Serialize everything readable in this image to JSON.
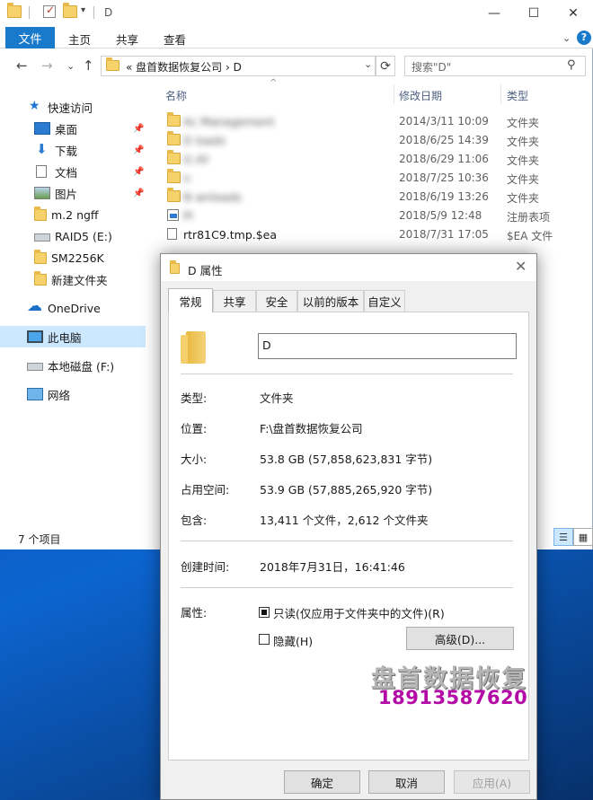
{
  "window": {
    "title": "D",
    "controls": {
      "minimize": "—",
      "maximize": "☐",
      "close": "✕"
    }
  },
  "ribbon": {
    "file": "文件",
    "tabs": [
      "主页",
      "共享",
      "查看"
    ],
    "expand": "⌄",
    "help": "?"
  },
  "nav": {
    "back": "←",
    "forward": "→",
    "recent": "⌄",
    "up": "↑",
    "address_path": "«  盘首数据恢复公司  ›  D",
    "address_dropdown": "⌄",
    "refresh": "⟳",
    "search_placeholder": "搜索\"D\"",
    "search_icon": "⚲"
  },
  "sidebar": {
    "items": [
      {
        "label": "快速访问",
        "icon": "star-icon"
      },
      {
        "label": "桌面",
        "icon": "desktop-icon",
        "pinned": true
      },
      {
        "label": "下载",
        "icon": "download-icon",
        "pinned": true
      },
      {
        "label": "文档",
        "icon": "document-icon",
        "pinned": true
      },
      {
        "label": "图片",
        "icon": "picture-icon",
        "pinned": true
      },
      {
        "label": "m.2 ngff",
        "icon": "folder-icon"
      },
      {
        "label": "RAID5 (E:)",
        "icon": "drive-icon"
      },
      {
        "label": "SM2256K",
        "icon": "folder-icon"
      },
      {
        "label": "新建文件夹",
        "icon": "folder-icon"
      },
      {
        "label": "OneDrive",
        "icon": "cloud-icon"
      },
      {
        "label": "此电脑",
        "icon": "computer-icon",
        "selected": true
      },
      {
        "label": "本地磁盘 (F:)",
        "icon": "drive-icon"
      },
      {
        "label": "网络",
        "icon": "network-icon"
      }
    ],
    "pin_glyph": "📌"
  },
  "file_list": {
    "columns": {
      "name": "名称",
      "date": "修改日期",
      "type": "类型"
    },
    "sort_caret": "^",
    "rows": [
      {
        "name": "Ac   Management",
        "date": "2014/3/11 10:09",
        "type": "文件夹",
        "icon": "folder-icon",
        "blurred": true
      },
      {
        "name": "D    loads",
        "date": "2018/6/25 14:39",
        "type": "文件夹",
        "icon": "folder-icon",
        "blurred": true
      },
      {
        "name": "G     AY",
        "date": "2018/6/29 11:06",
        "type": "文件夹",
        "icon": "folder-icon",
        "blurred": true
      },
      {
        "name": "n",
        "date": "2018/7/25 10:36",
        "type": "文件夹",
        "icon": "folder-icon",
        "blurred": true
      },
      {
        "name": "N   wnloads",
        "date": "2018/6/19 13:26",
        "type": "文件夹",
        "icon": "folder-icon",
        "blurred": true
      },
      {
        "name": "Pl",
        "date": "2018/5/9 12:48",
        "type": "注册表项",
        "icon": "registry-file-icon",
        "blurred": true
      },
      {
        "name": "rtr81C9.tmp.$ea",
        "date": "2018/7/31 17:05",
        "type": "$EA 文件",
        "icon": "file-icon",
        "blurred": false
      }
    ]
  },
  "status": {
    "item_count": "7 个项目",
    "view_details": "☰",
    "view_icons": "▦"
  },
  "dialog": {
    "title": "D 属性",
    "close": "✕",
    "tabs": [
      "常规",
      "共享",
      "安全",
      "以前的版本",
      "自定义"
    ],
    "folder_name": "D",
    "type_label": "类型:",
    "type_value": "文件夹",
    "location_label": "位置:",
    "location_value": "F:\\盘首数据恢复公司",
    "size_label": "大小:",
    "size_value": "53.8 GB (57,858,623,831 字节)",
    "size_on_disk_label": "占用空间:",
    "size_on_disk_value": "53.9 GB (57,885,265,920 字节)",
    "contains_label": "包含:",
    "contains_value": "13,411 个文件，2,612 个文件夹",
    "created_label": "创建时间:",
    "created_value": "2018年7月31日，16:41:46",
    "attributes_label": "属性:",
    "readonly_label": "只读(仅应用于文件夹中的文件)(R)",
    "readonly_checked": true,
    "hidden_label": "隐藏(H)",
    "hidden_checked": false,
    "advanced_button": "高级(D)...",
    "ok_button": "确定",
    "cancel_button": "取消",
    "apply_button": "应用(A)"
  },
  "watermark": {
    "company": "盘首数据恢复",
    "phone": "18913587620"
  }
}
